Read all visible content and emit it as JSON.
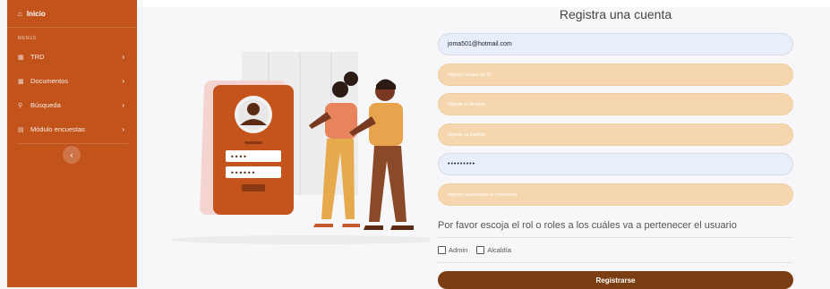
{
  "colors": {
    "sidebar": "#c1531b",
    "field_empty": "#f5d6ae",
    "field_filled": "#e8eefa",
    "button": "#7a3e12"
  },
  "sidebar": {
    "home": {
      "icon": "home-icon",
      "label": "Inicio"
    },
    "section_label": "MENÚS",
    "items": [
      {
        "icon": "grid-icon",
        "label": "TRD"
      },
      {
        "icon": "folder-icon",
        "label": "Documentos"
      },
      {
        "icon": "search-icon",
        "label": "Búsqueda"
      },
      {
        "icon": "list-icon",
        "label": "Módulo encuestas"
      }
    ],
    "toggle_icon": "chevron-left-icon"
  },
  "form": {
    "title": "Registra una cuenta",
    "fields": [
      {
        "name": "email",
        "value": "joma501@hotmail.com",
        "placeholder": ""
      },
      {
        "name": "id",
        "value": "",
        "placeholder": "Ingrese número de ID"
      },
      {
        "name": "nombre",
        "value": "",
        "placeholder": "Ingrese su Nombre"
      },
      {
        "name": "apellido",
        "value": "",
        "placeholder": "Ingrese su Apellido"
      },
      {
        "name": "password",
        "value": "•••••••••",
        "placeholder": ""
      },
      {
        "name": "password_confirm",
        "value": "",
        "placeholder": "Ingrese nuevamente la contraseña"
      }
    ],
    "roles_question": "Por favor escoja el rol o roles a los cuáles va a pertenecer el usuario",
    "roles": [
      {
        "label": "Admin",
        "checked": false
      },
      {
        "label": "Alcaldía",
        "checked": false
      }
    ],
    "submit_label": "Registrarse"
  },
  "illustration": {
    "pin_mask_1": "••••",
    "pin_mask_2": "••••••"
  }
}
